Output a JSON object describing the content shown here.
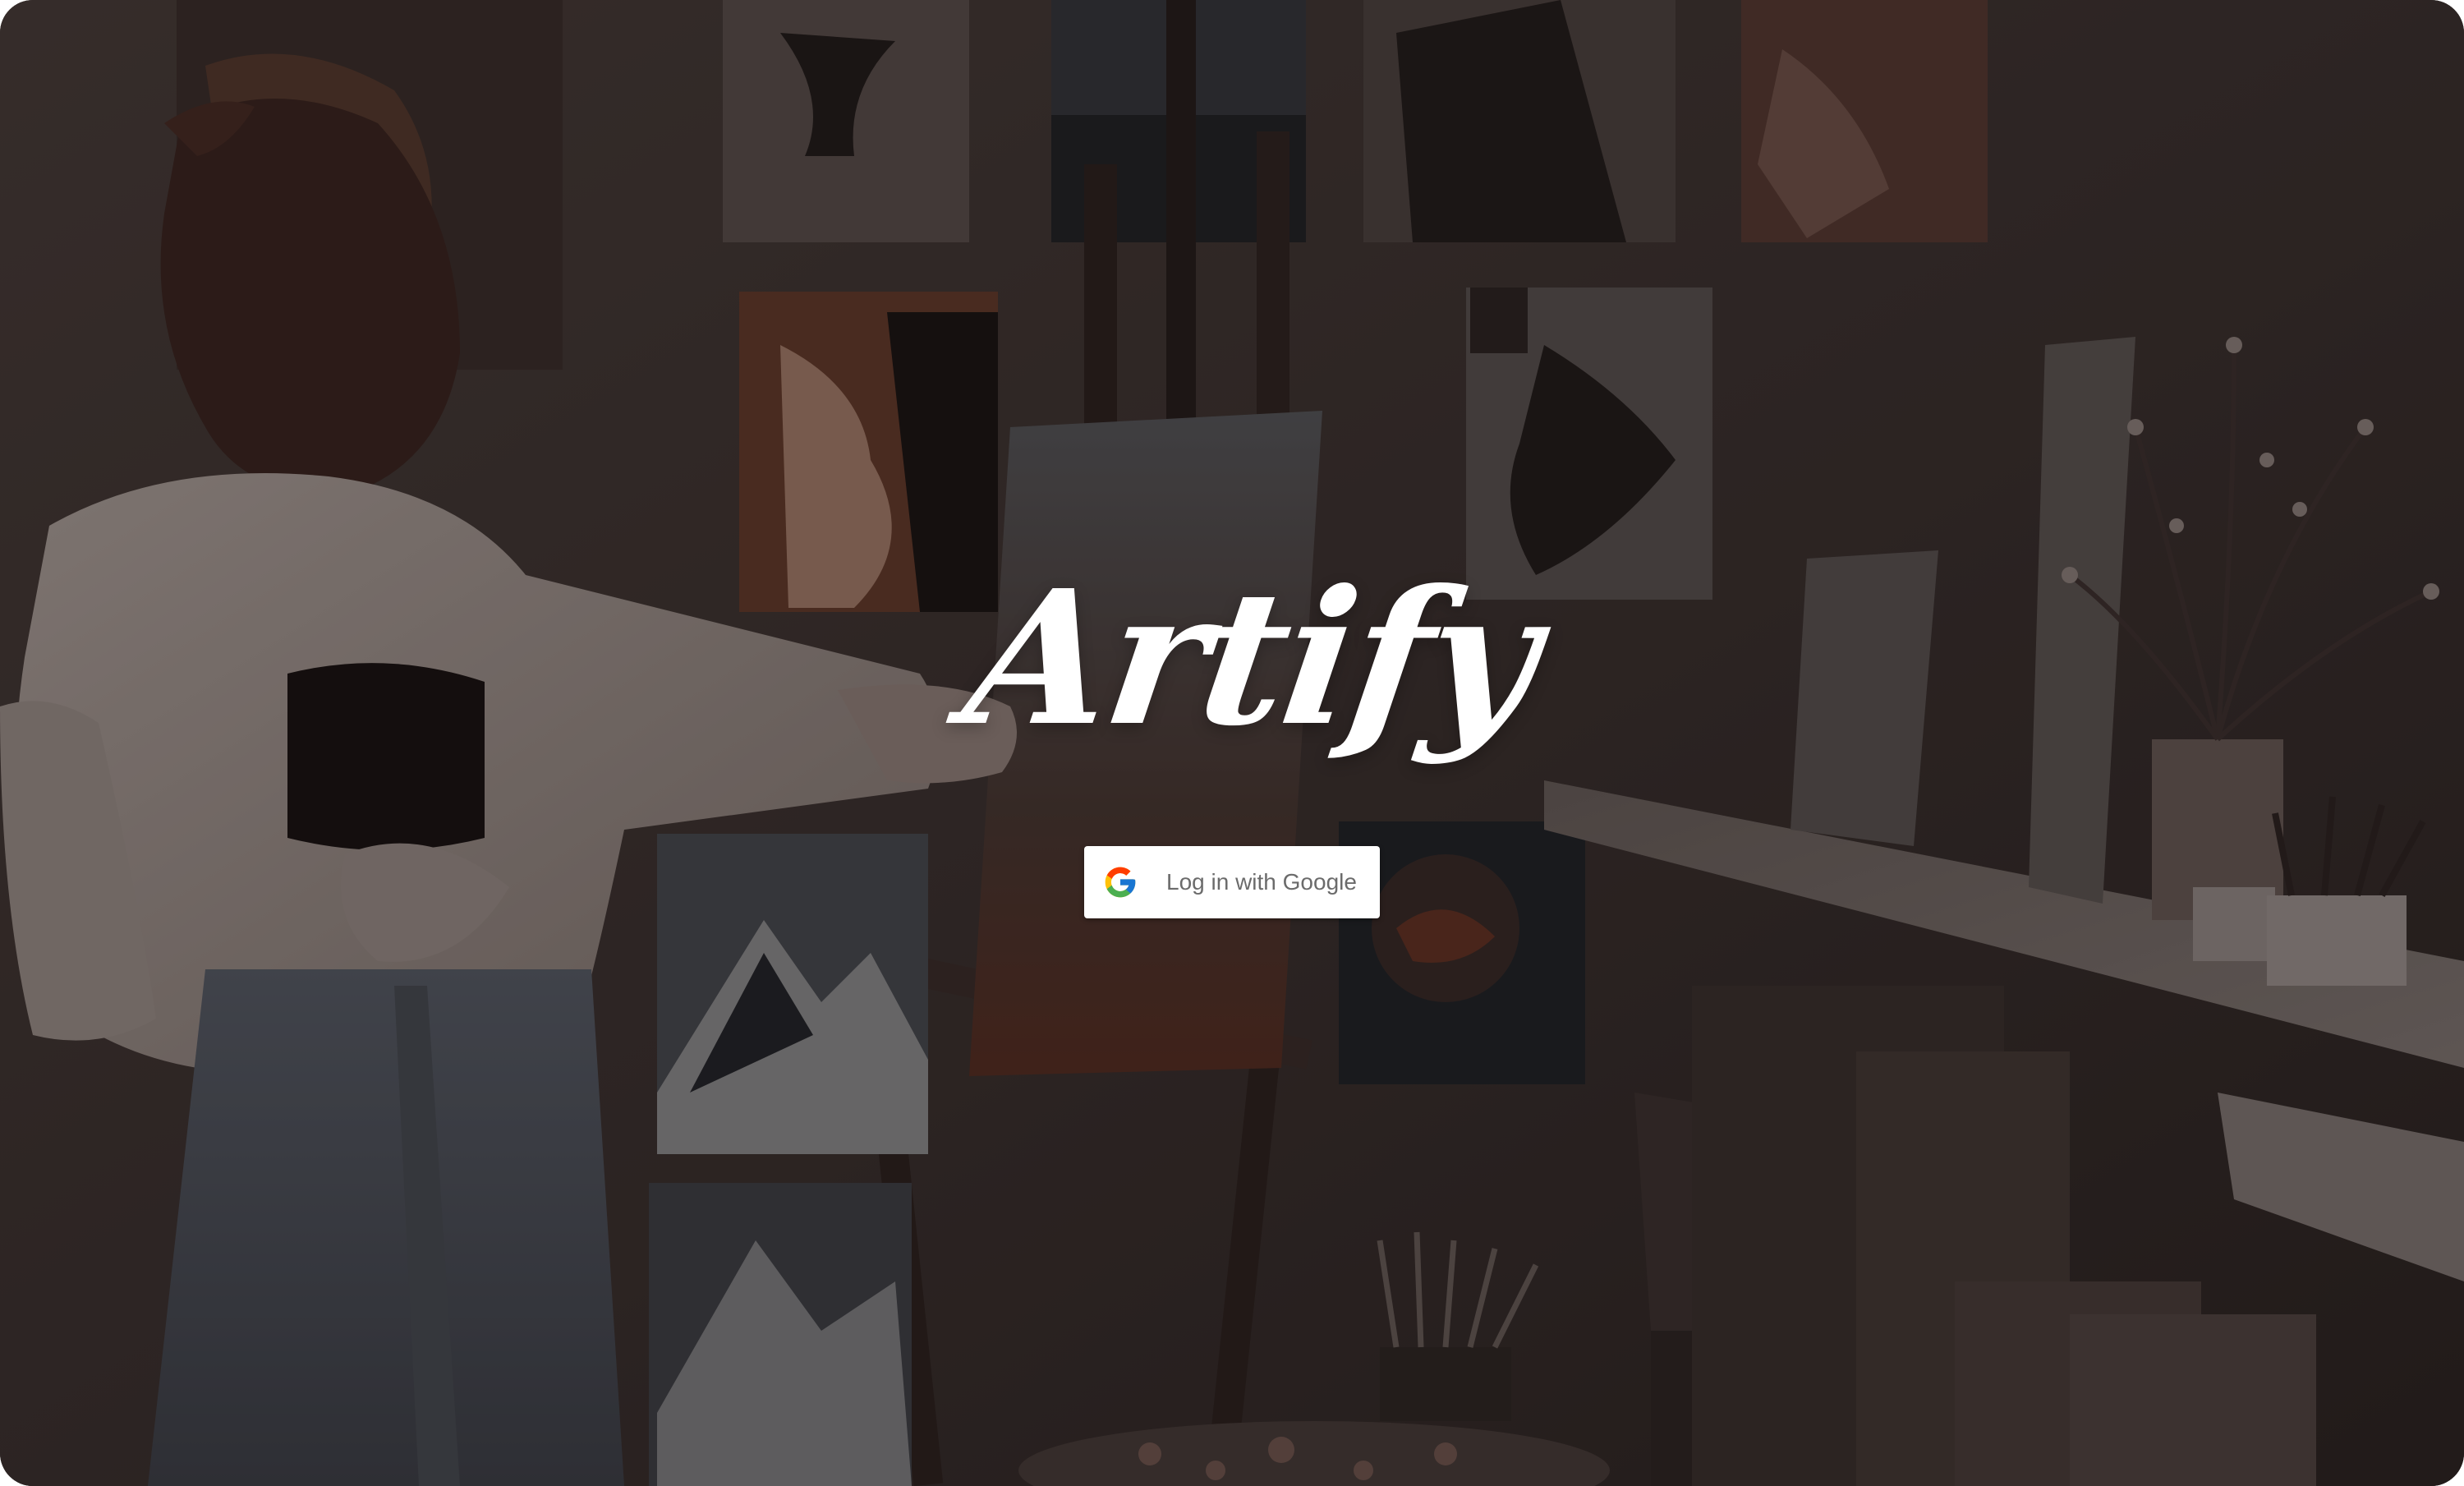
{
  "app": {
    "title": "Artify"
  },
  "login": {
    "google_button_label": "Log in with Google",
    "google_icon": "google-g-icon"
  },
  "colors": {
    "overlay": "#140e0c",
    "button_bg": "#ffffff",
    "button_text": "#6b6b6b",
    "logo_text": "#ffffff"
  }
}
